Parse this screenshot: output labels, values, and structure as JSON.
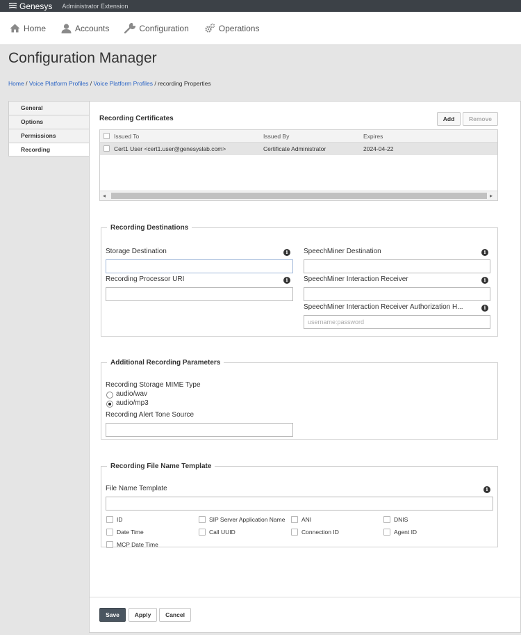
{
  "topbar": {
    "brand": "Genesys",
    "app": "Administrator Extension"
  },
  "nav": [
    {
      "label": "Home",
      "icon": "home-icon"
    },
    {
      "label": "Accounts",
      "icon": "user-icon"
    },
    {
      "label": "Configuration",
      "icon": "wrench-icon"
    },
    {
      "label": "Operations",
      "icon": "gears-icon"
    }
  ],
  "page_title": "Configuration Manager",
  "breadcrumb": {
    "links": [
      "Home",
      "Voice Platform Profiles",
      "Voice Platform Profiles"
    ],
    "separator": "/",
    "current": "recording Properties"
  },
  "tabs": [
    "General",
    "Options",
    "Permissions",
    "Recording"
  ],
  "active_tab": "Recording",
  "certificates": {
    "title": "Recording Certificates",
    "add_label": "Add",
    "remove_label": "Remove",
    "columns": [
      "Issued To",
      "Issued By",
      "Expires"
    ],
    "rows": [
      {
        "issued_to": "Cert1 User <cert1.user@genesyslab.com>",
        "issued_by": "Certificate Administrator",
        "expires": "2024-04-22"
      }
    ]
  },
  "destinations": {
    "legend": "Recording Destinations",
    "storage_label": "Storage Destination",
    "storage_value": "",
    "speechminer_dest_label": "SpeechMiner Destination",
    "speechminer_dest_value": "",
    "processor_label": "Recording Processor URI",
    "processor_value": "",
    "receiver_label": "SpeechMiner Interaction Receiver",
    "receiver_value": "",
    "auth_label": "SpeechMiner Interaction Receiver Authorization H...",
    "auth_placeholder": "username:password"
  },
  "additional": {
    "legend": "Additional Recording Parameters",
    "mime_label": "Recording Storage MIME Type",
    "mime_options": [
      "audio/wav",
      "audio/mp3"
    ],
    "mime_selected": "audio/mp3",
    "tone_label": "Recording Alert Tone Source",
    "tone_value": ""
  },
  "filename": {
    "legend": "Recording File Name Template",
    "template_label": "File Name Template",
    "template_value": "",
    "checkboxes": [
      "ID",
      "SIP Server Application Name",
      "ANI",
      "DNIS",
      "Date Time",
      "Call UUID",
      "Connection ID",
      "Agent ID",
      "MCP Date Time"
    ]
  },
  "footer": {
    "save": "Save",
    "apply": "Apply",
    "cancel": "Cancel"
  },
  "colors": {
    "topbar": "#3c4147",
    "link": "#2a64c5",
    "save_button": "#4a5560"
  }
}
